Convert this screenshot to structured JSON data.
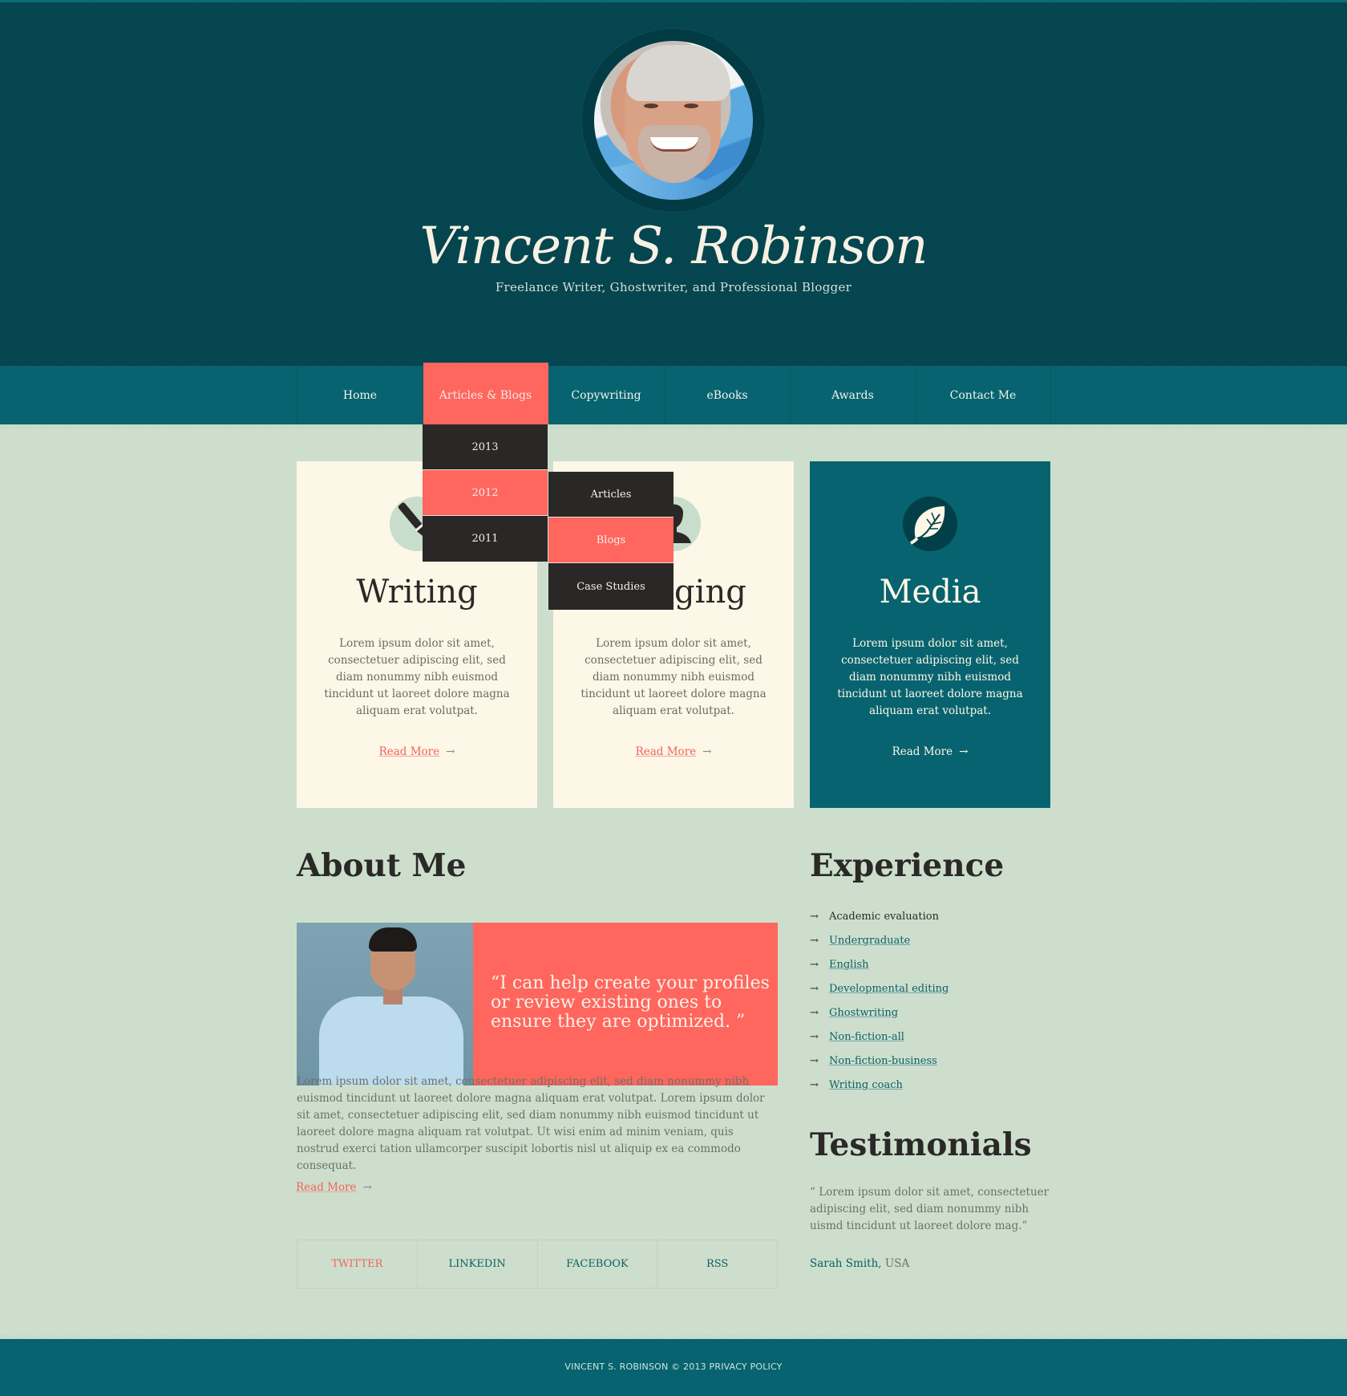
{
  "header": {
    "name": "Vincent S. Robinson",
    "tagline": "Freelance Writer, Ghostwriter, and Professional Blogger"
  },
  "nav": {
    "items": [
      {
        "label": "Home"
      },
      {
        "label": "Articles & Blogs",
        "active": true
      },
      {
        "label": "Copywriting"
      },
      {
        "label": "eBooks"
      },
      {
        "label": "Awards"
      },
      {
        "label": "Contact Me"
      }
    ],
    "dropdown": [
      {
        "label": "2013"
      },
      {
        "label": "2012",
        "active": true
      },
      {
        "label": "2011"
      }
    ],
    "submenu": [
      {
        "label": "Articles"
      },
      {
        "label": "Blogs",
        "active": true
      },
      {
        "label": "Case Studies"
      }
    ]
  },
  "cards": [
    {
      "icon": "pen-icon",
      "title": "Writing",
      "text": "Lorem ipsum dolor sit amet, consectetuer adipiscing elit, sed diam nonummy nibh euismod tincidunt ut laoreet dolore magna aliquam erat volutpat.",
      "more": "Read More",
      "arrow": "→"
    },
    {
      "icon": "user-silhouette-icon",
      "title": "Blogging",
      "text": "Lorem ipsum dolor sit amet, consectetuer adipiscing elit, sed diam nonummy nibh euismod tincidunt ut laoreet dolore magna aliquam erat volutpat.",
      "more": "Read More",
      "arrow": "→"
    },
    {
      "icon": "leaf-icon",
      "title": "Media",
      "text": "Lorem ipsum dolor sit amet, consectetuer adipiscing elit, sed diam nonummy nibh euismod tincidunt ut laoreet dolore magna aliquam erat volutpat.",
      "more": "Read More",
      "arrow": "→"
    }
  ],
  "about": {
    "heading": "About Me",
    "quote": "“I can help create your profiles or review existing ones to ensure they are optimized. ”",
    "text": "Lorem ipsum dolor sit amet, consectetuer adipiscing elit, sed diam nonummy nibh euismod tincidunt ut laoreet dolore magna aliquam erat volutpat. Lorem ipsum dolor sit amet, consectetuer adipiscing elit, sed diam nonummy nibh euismod tincidunt ut laoreet dolore magna aliquam rat volutpat. Ut wisi enim ad minim veniam, quis nostrud exerci tation ullamcorper suscipit lobortis nisl ut aliquip ex ea commodo consequat.",
    "more": "Read More",
    "arrow": "→"
  },
  "social": [
    {
      "label": "TWITTER",
      "active": true
    },
    {
      "label": "LINKEDIN"
    },
    {
      "label": "FACEBOOK"
    },
    {
      "label": "RSS"
    }
  ],
  "experience": {
    "heading": "Experience",
    "bullet": "→",
    "items": [
      "Academic evaluation",
      "Undergraduate",
      "English",
      "Developmental editing",
      "Ghostwriting",
      "Non-fiction-all",
      "Non-fiction-business",
      "Writing coach"
    ]
  },
  "testimonials": {
    "heading": "Testimonials",
    "text": "“ Lorem ipsum dolor sit amet, consectetuer adipiscing elit, sed diam nonummy nibh uismd tincidunt ut laoreet dolore mag.”",
    "author": "Sarah Smith,",
    "location": "USA"
  },
  "footer": {
    "text": "VINCENT S. ROBINSON © 2013 PRIVACY POLICY"
  },
  "colors": {
    "header_bg": "#03454f",
    "nav_bg": "#07636f",
    "accent": "#fe665e",
    "page_bg": "#cddfcc",
    "card_bg": "#fdf7e7",
    "dropdown_bg": "#2a2826"
  }
}
